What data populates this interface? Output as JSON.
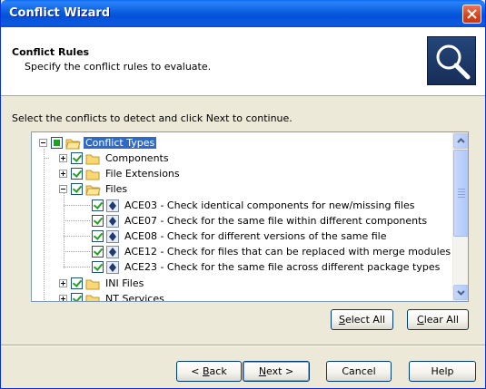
{
  "window": {
    "title": "Conflict Wizard",
    "accent_color": "#0a5ee0",
    "close_icon": "close-icon"
  },
  "header": {
    "title": "Conflict Rules",
    "subtitle": "Specify the conflict rules to evaluate.",
    "icon": "magnifier-icon"
  },
  "instruction": "Select the conflicts to detect and click Next to continue.",
  "tree": {
    "root": {
      "label": "Conflict Types",
      "selected": true
    },
    "items": [
      {
        "label": "Components",
        "expanded": false
      },
      {
        "label": "File Extensions",
        "expanded": false
      },
      {
        "label": "Files",
        "expanded": true
      },
      {
        "label": "ACE03 - Check identical components for new/missing files"
      },
      {
        "label": "ACE07 - Check for the same file within different components"
      },
      {
        "label": "ACE08 - Check for different versions of the same file"
      },
      {
        "label": "ACE12 - Check for files that can be replaced with merge modules"
      },
      {
        "label": "ACE23 - Check for the same file across different package types"
      },
      {
        "label": "INI Files",
        "expanded": false
      },
      {
        "label": "NT Services",
        "expanded": false
      }
    ]
  },
  "buttons": {
    "select_all_pre": "",
    "select_all_key": "S",
    "select_all_post": "elect All",
    "clear_all_key": "C",
    "clear_all_post": "lear All",
    "back_pre": "< ",
    "back_key": "B",
    "back_post": "ack",
    "next_key": "N",
    "next_post": "ext >",
    "cancel": "Cancel",
    "help": "Help"
  }
}
